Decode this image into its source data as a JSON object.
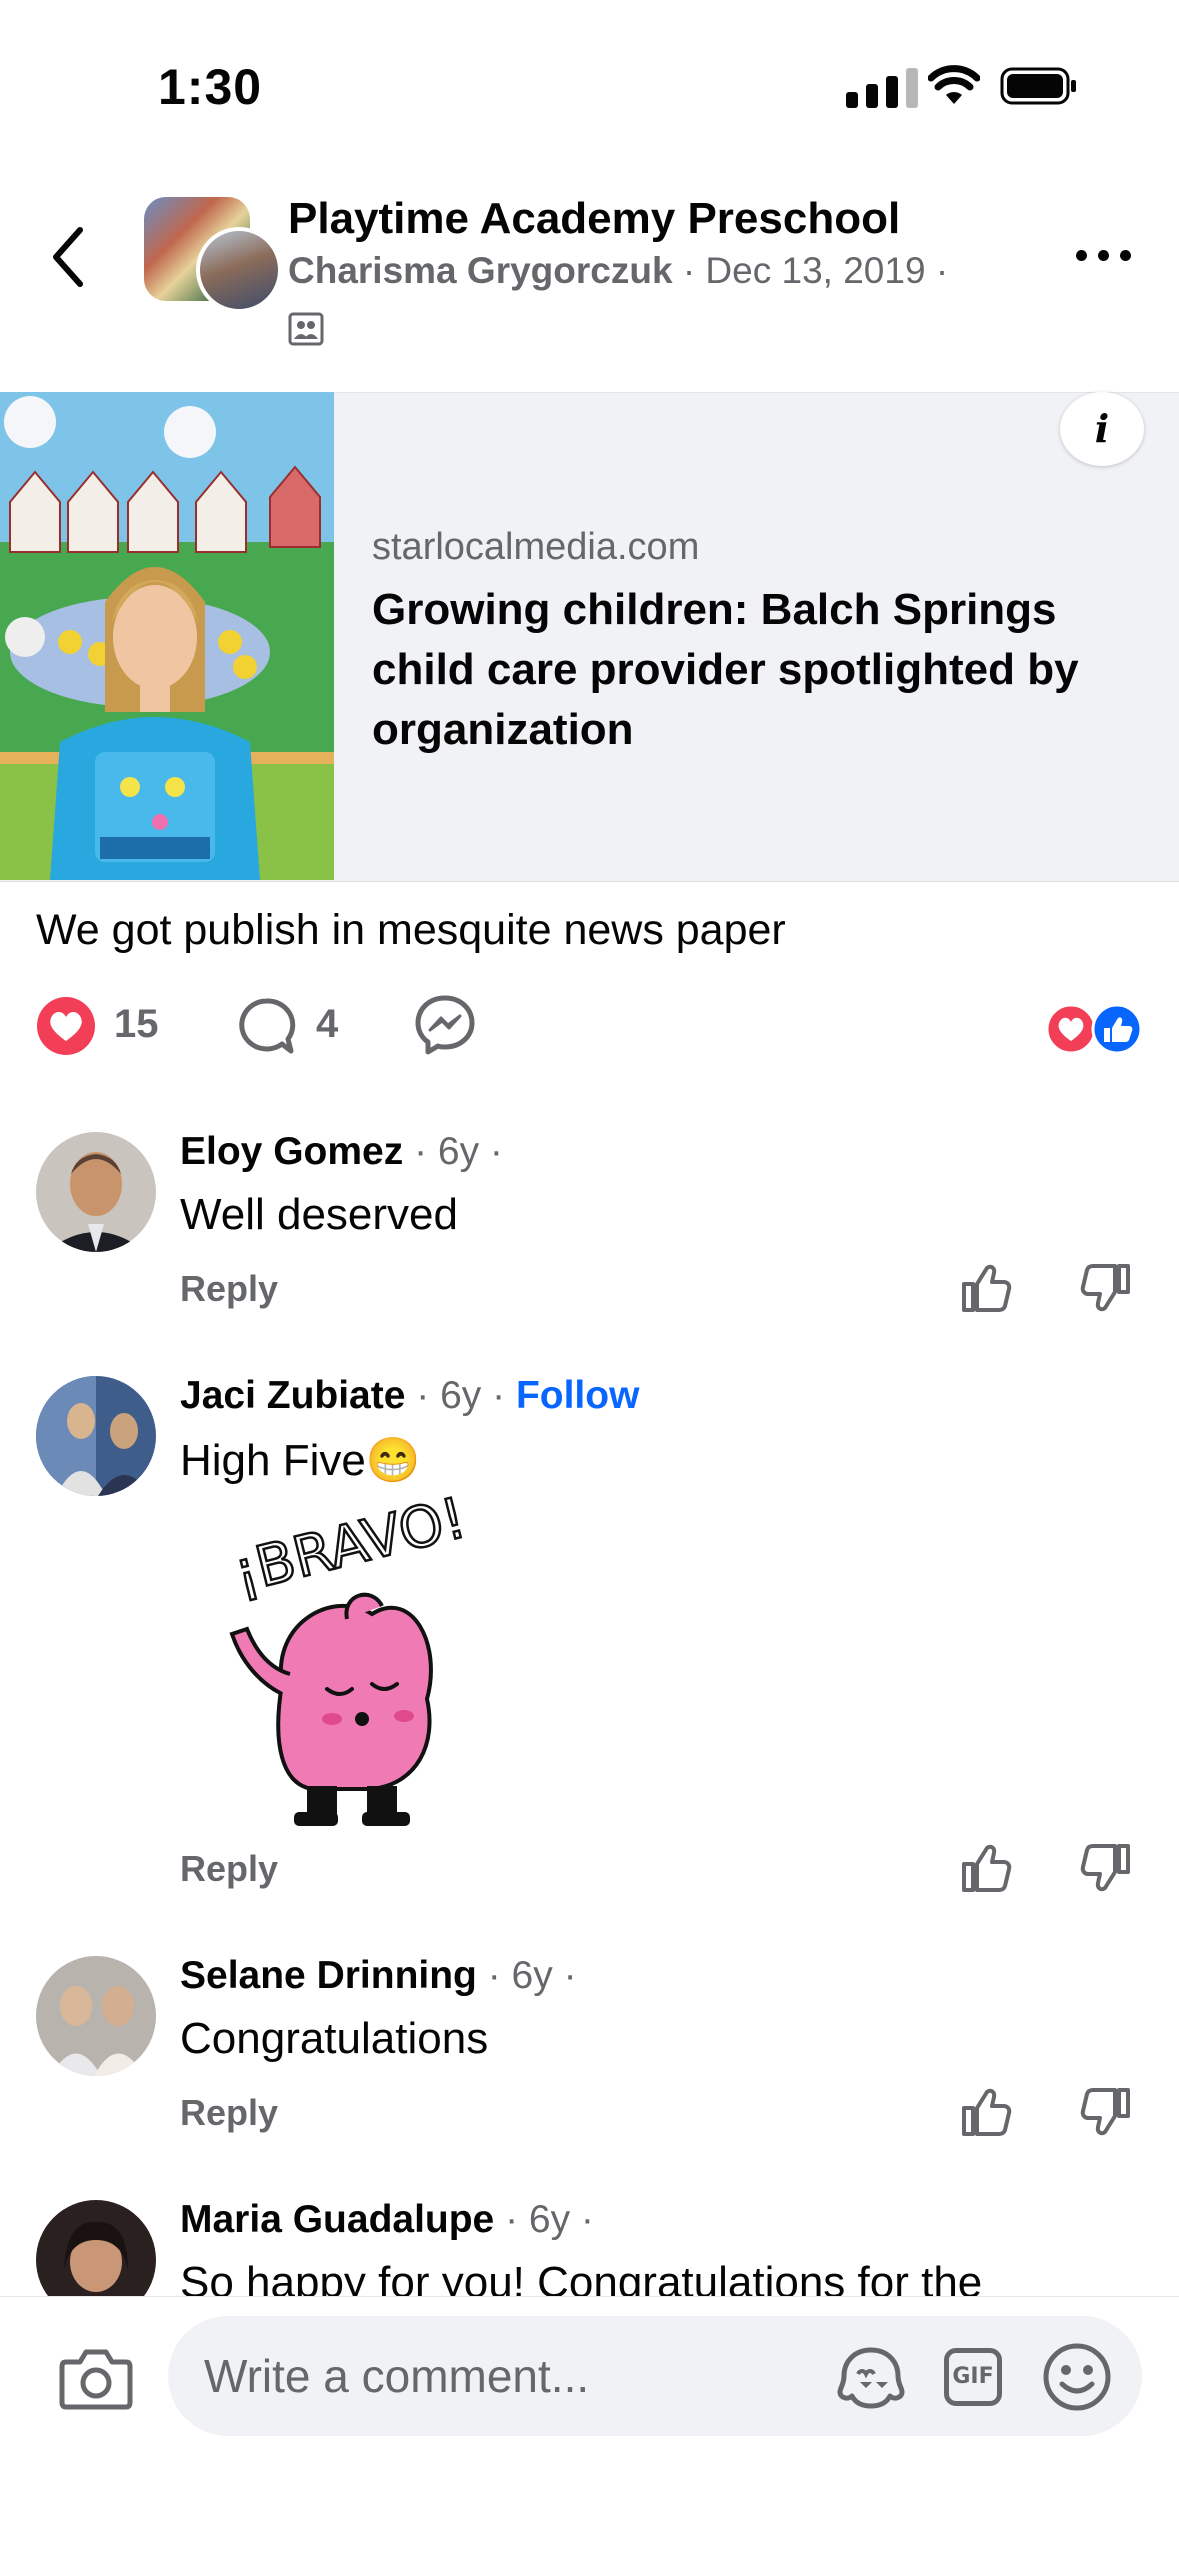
{
  "status_bar": {
    "time": "1:30"
  },
  "header": {
    "page_name": "Playtime Academy Preschool",
    "author": "Charisma Grygorczuk",
    "date": "Dec 13, 2019",
    "separator": "·"
  },
  "link_card": {
    "domain": "starlocalmedia.com",
    "headline": "Growing children: Balch Springs child care provider spotlighted by organization",
    "info_label": "i"
  },
  "post": {
    "caption": "We got publish in mesquite news paper",
    "reaction_count": "15",
    "comment_count": "4"
  },
  "comments": [
    {
      "name": "Eloy Gomez",
      "meta": " · 6y ·",
      "text": "Well deserved",
      "reply": "Reply"
    },
    {
      "name": "Jaci Zubiate",
      "meta": " · 6y · ",
      "follow": "Follow",
      "text": "High Five😁",
      "sticker_text": "¡BRAVO!",
      "reply": "Reply"
    },
    {
      "name": "Selane Drinning",
      "meta": " · 6y ·",
      "text": "Congratulations",
      "reply": "Reply"
    },
    {
      "name": "Maria Guadalupe",
      "meta": " · 6y ·",
      "text": "So happy for you! Congratulations for the"
    }
  ],
  "composer": {
    "placeholder": "Write a comment...",
    "gif_label": "GIF"
  },
  "colors": {
    "accent_blue": "#0866ff",
    "love_red": "#f33e58",
    "secondary_text": "#65676b",
    "card_bg": "#f0f2f5"
  }
}
